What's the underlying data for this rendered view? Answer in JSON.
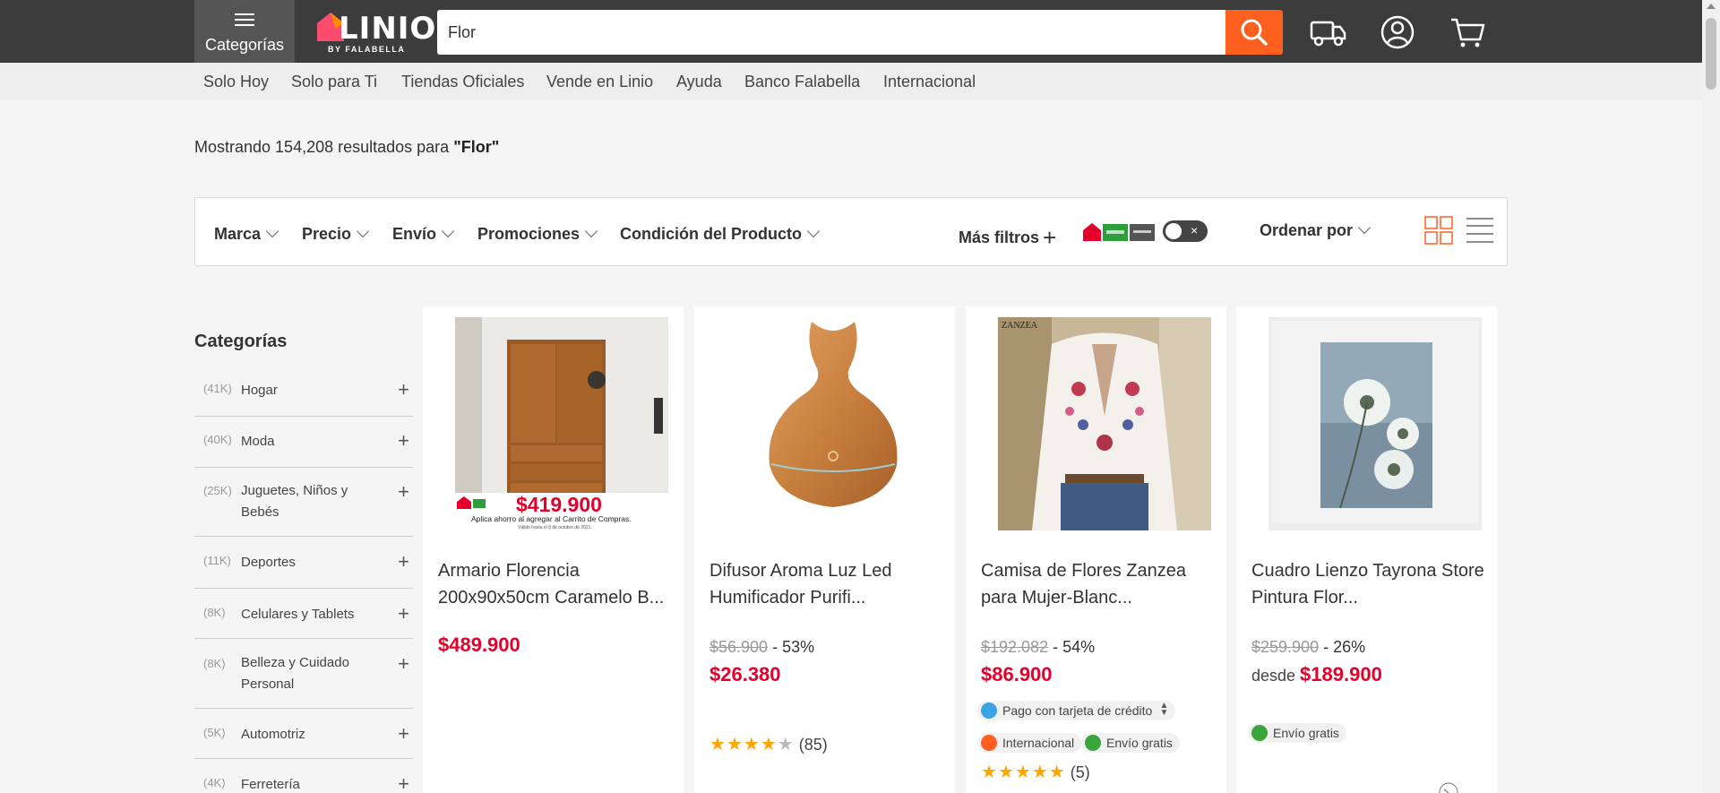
{
  "header": {
    "categories_label": "Categorías",
    "logo_text": "LINIO",
    "logo_sub": "BY FALABELLA",
    "search_value": "Flor"
  },
  "subnav": [
    "Solo Hoy",
    "Solo para Ti",
    "Tiendas Oficiales",
    "Vende en Linio",
    "Ayuda",
    "Banco Falabella",
    "Internacional"
  ],
  "results": {
    "prefix": "Mostrando 154,208 resultados para ",
    "query": "\"Flor\""
  },
  "filters": {
    "items": [
      "Marca",
      "Precio",
      "Envío",
      "Promociones",
      "Condición del Producto"
    ],
    "more": "Más filtros",
    "sort": "Ordenar por",
    "toggle_x": "×"
  },
  "sidebar": {
    "title": "Categorías",
    "items": [
      {
        "count": "(41K)",
        "name": "Hogar"
      },
      {
        "count": "(40K)",
        "name": "Moda"
      },
      {
        "count": "(25K)",
        "name": "Juguetes, Niños y Bebés"
      },
      {
        "count": "(11K)",
        "name": "Deportes"
      },
      {
        "count": "(8K)",
        "name": "Celulares y Tablets"
      },
      {
        "count": "(8K)",
        "name": "Belleza y Cuidado Personal"
      },
      {
        "count": "(5K)",
        "name": "Automotriz"
      },
      {
        "count": "(4K)",
        "name": "Ferretería"
      }
    ]
  },
  "products": [
    {
      "title": "Armario Florencia 200x90x50cm Caramelo B...",
      "price": "$489.900",
      "image_price": "$419.900",
      "image_note": "Aplica ahorro al agregar al Carrito de Compras.",
      "image_note2": "Válido hasta el 8 de octubre de 2021."
    },
    {
      "title": "Difusor Aroma Luz Led Humificador Purifi...",
      "old_price": "$56.900",
      "discount": " - 53%",
      "price": "$26.380",
      "rating": 4,
      "reviews": "(85)"
    },
    {
      "title": "Camisa de Flores Zanzea para Mujer-Blanc...",
      "old_price": "$192.082",
      "discount": " - 54%",
      "price": "$86.900",
      "brand_mark": "ZANZEA",
      "pay_pill": "Pago con tarjeta de crédito",
      "intl_pill": "Internacional",
      "ship_pill": "Envío gratis",
      "rating": 5,
      "reviews": "(5)"
    },
    {
      "title": "Cuadro Lienzo Tayrona Store Pintura Flor...",
      "old_price": "$259.900",
      "discount": " - 26%",
      "desde": "desde ",
      "price": "$189.900",
      "ship_pill": "Envío gratis"
    }
  ],
  "colors": {
    "header_bg": "#3c3c3c",
    "accent": "#ff5f1f",
    "price_red": "#e4002b"
  }
}
